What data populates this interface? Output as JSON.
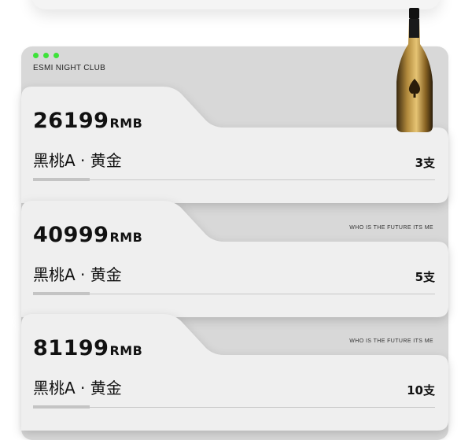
{
  "club_name": "ESMI NIGHT CLUB",
  "tickets": [
    {
      "price": "26199",
      "unit": "RMB",
      "product": "黑桃A · 黄金",
      "quantity": "3支",
      "slogan": ""
    },
    {
      "price": "40999",
      "unit": "RMB",
      "product": "黑桃A · 黄金",
      "quantity": "5支",
      "slogan": "WHO IS THE FUTURE ITS ME"
    },
    {
      "price": "81199",
      "unit": "RMB",
      "product": "黑桃A · 黄金",
      "quantity": "10支",
      "slogan": "WHO IS THE FUTURE ITS ME"
    }
  ],
  "colors": {
    "dots": "#3ee23a",
    "panel": "#d8d8d8",
    "card": "#efefef",
    "bottle_gold": "#c9a14a"
  },
  "icons": [
    "champagne-bottle-image"
  ]
}
